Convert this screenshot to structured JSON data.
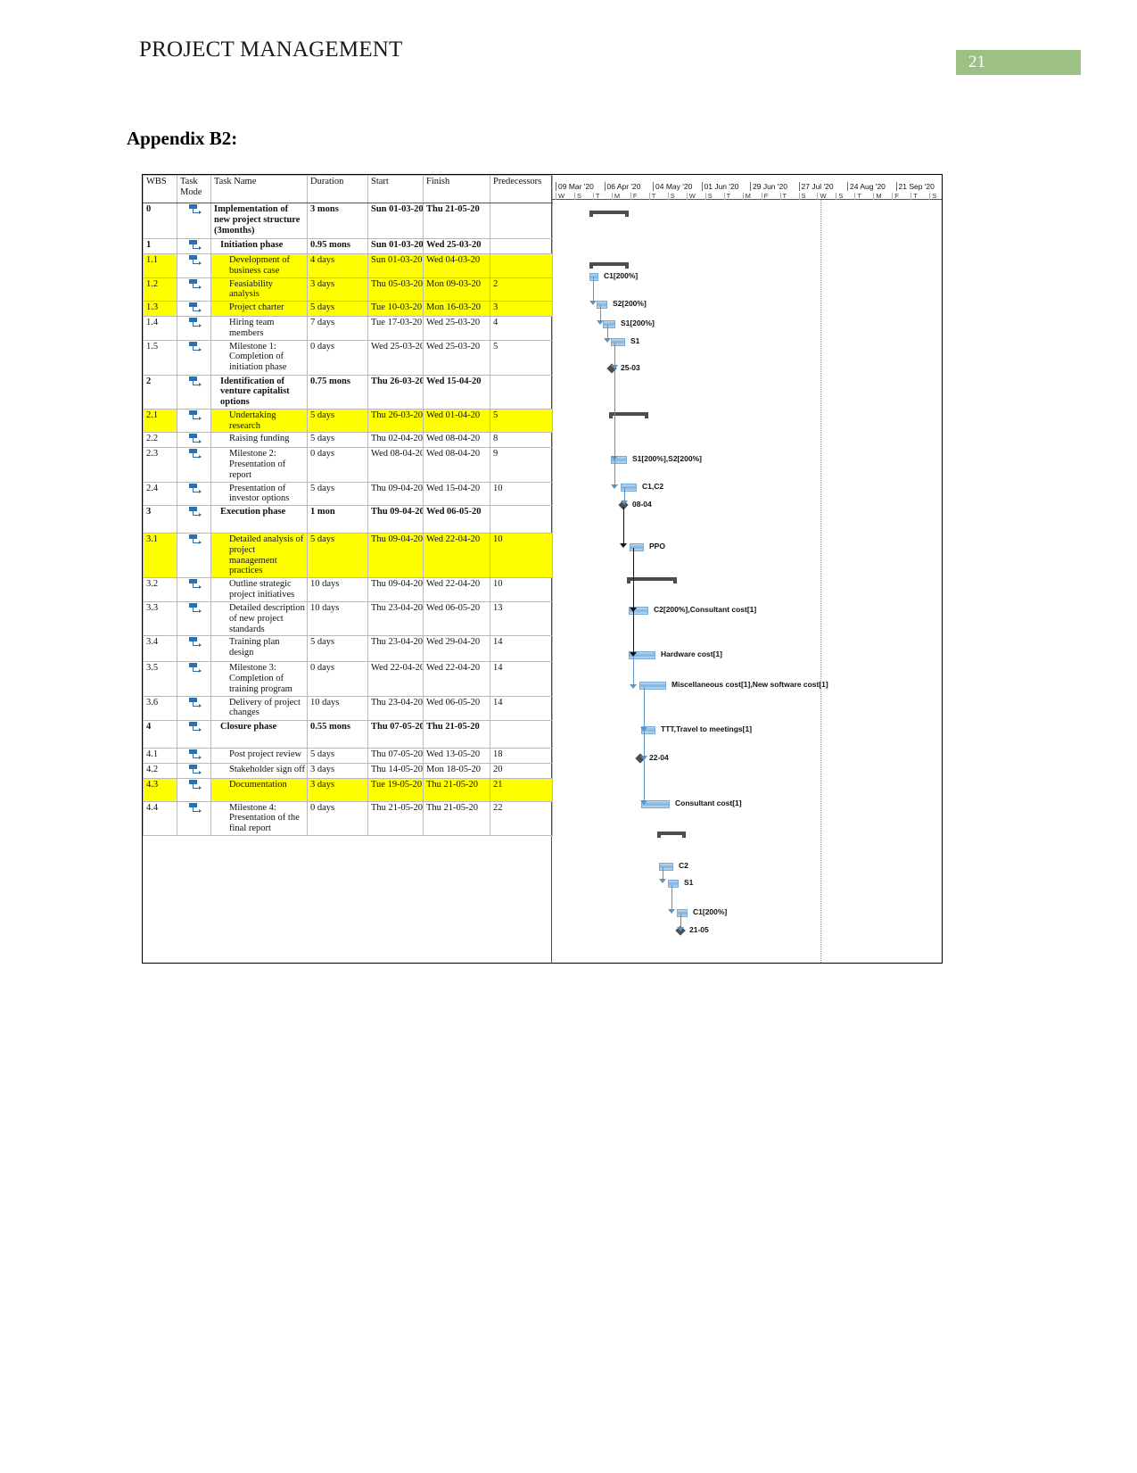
{
  "header": {
    "title": "PROJECT MANAGEMENT",
    "page_number": "21",
    "badge_color": "#9dc184"
  },
  "appendix": {
    "title": "Appendix B2:"
  },
  "table": {
    "columns": [
      "WBS",
      "Task Mode",
      "Task Name",
      "Duration",
      "Start",
      "Finish",
      "Predecessors"
    ],
    "column_headers": {
      "wbs": "WBS",
      "task_mode_line1": "Task",
      "task_mode_line2": "Mode",
      "task_name": "Task Name",
      "duration": "Duration",
      "start": "Start",
      "finish": "Finish",
      "predecessors": "Predecessors"
    },
    "highlight_color": "#ffff00",
    "rows": [
      {
        "wbs": "0",
        "name": "Implementation of new project structure (3months)",
        "duration": "3 mons",
        "start": "Sun 01-03-20",
        "finish": "Thu 21-05-20",
        "pred": "",
        "level": 0,
        "highlight": false
      },
      {
        "wbs": "1",
        "name": "Initiation phase",
        "duration": "0.95 mons",
        "start": "Sun 01-03-20",
        "finish": "Wed 25-03-20",
        "pred": "",
        "level": 1,
        "highlight": false
      },
      {
        "wbs": "1.1",
        "name": "Development of business case",
        "duration": "4 days",
        "start": "Sun 01-03-20",
        "finish": "Wed 04-03-20",
        "pred": "",
        "level": 2,
        "highlight": true
      },
      {
        "wbs": "1.2",
        "name": "Feasiability analysis",
        "duration": "3 days",
        "start": "Thu 05-03-20",
        "finish": "Mon 09-03-20",
        "pred": "2",
        "level": 2,
        "highlight": true
      },
      {
        "wbs": "1.3",
        "name": "Project charter",
        "duration": "5 days",
        "start": "Tue 10-03-20",
        "finish": "Mon 16-03-20",
        "pred": "3",
        "level": 2,
        "highlight": true
      },
      {
        "wbs": "1.4",
        "name": "Hiring team members",
        "duration": "7 days",
        "start": "Tue 17-03-20",
        "finish": "Wed 25-03-20",
        "pred": "4",
        "level": 2,
        "highlight": false
      },
      {
        "wbs": "1.5",
        "name": "Milestone 1: Completion of initiation phase",
        "duration": "0 days",
        "start": "Wed 25-03-20",
        "finish": "Wed 25-03-20",
        "pred": "5",
        "level": 2,
        "highlight": false
      },
      {
        "wbs": "2",
        "name": "Identification of venture capitalist options",
        "duration": "0.75 mons",
        "start": "Thu 26-03-20",
        "finish": "Wed 15-04-20",
        "pred": "",
        "level": 1,
        "highlight": false
      },
      {
        "wbs": "2.1",
        "name": "Undertaking research",
        "duration": "5 days",
        "start": "Thu 26-03-20",
        "finish": "Wed 01-04-20",
        "pred": "5",
        "level": 2,
        "highlight": true
      },
      {
        "wbs": "2.2",
        "name": "Raising funding",
        "duration": "5 days",
        "start": "Thu 02-04-20",
        "finish": "Wed 08-04-20",
        "pred": "8",
        "level": 2,
        "highlight": false
      },
      {
        "wbs": "2.3",
        "name": "Milestone 2: Presentation of report",
        "duration": "0 days",
        "start": "Wed 08-04-20",
        "finish": "Wed 08-04-20",
        "pred": "9",
        "level": 2,
        "highlight": false
      },
      {
        "wbs": "2.4",
        "name": "Presentation of investor options",
        "duration": "5 days",
        "start": "Thu 09-04-20",
        "finish": "Wed 15-04-20",
        "pred": "10",
        "level": 2,
        "highlight": false
      },
      {
        "wbs": "3",
        "name": "Execution phase",
        "duration": "1 mon",
        "start": "Thu 09-04-20",
        "finish": "Wed 06-05-20",
        "pred": "",
        "level": 1,
        "highlight": false
      },
      {
        "wbs": "3.1",
        "name": "Detailed analysis of project management practices",
        "duration": "5 days",
        "start": "Thu 09-04-20",
        "finish": "Wed 22-04-20",
        "pred": "10",
        "level": 2,
        "highlight": true
      },
      {
        "wbs": "3.2",
        "name": "Outline strategic project initiatives",
        "duration": "10 days",
        "start": "Thu 09-04-20",
        "finish": "Wed 22-04-20",
        "pred": "10",
        "level": 2,
        "highlight": false
      },
      {
        "wbs": "3.3",
        "name": "Detailed description of new project standards",
        "duration": "10 days",
        "start": "Thu 23-04-20",
        "finish": "Wed 06-05-20",
        "pred": "13",
        "level": 2,
        "highlight": false
      },
      {
        "wbs": "3.4",
        "name": "Training plan design",
        "duration": "5 days",
        "start": "Thu 23-04-20",
        "finish": "Wed 29-04-20",
        "pred": "14",
        "level": 2,
        "highlight": false
      },
      {
        "wbs": "3.5",
        "name": "Milestone 3: Completion of training program",
        "duration": "0 days",
        "start": "Wed 22-04-20",
        "finish": "Wed 22-04-20",
        "pred": "14",
        "level": 2,
        "highlight": false
      },
      {
        "wbs": "3.6",
        "name": "Delivery of project changes",
        "duration": "10 days",
        "start": "Thu 23-04-20",
        "finish": "Wed 06-05-20",
        "pred": "14",
        "level": 2,
        "highlight": false
      },
      {
        "wbs": "4",
        "name": "Closure phase",
        "duration": "0.55 mons",
        "start": "Thu 07-05-20",
        "finish": "Thu 21-05-20",
        "pred": "",
        "level": 1,
        "highlight": false
      },
      {
        "wbs": "4.1",
        "name": "Post project review",
        "duration": "5 days",
        "start": "Thu 07-05-20",
        "finish": "Wed 13-05-20",
        "pred": "18",
        "level": 2,
        "highlight": false
      },
      {
        "wbs": "4.2",
        "name": "Stakeholder sign off",
        "duration": "3 days",
        "start": "Thu 14-05-20",
        "finish": "Mon 18-05-20",
        "pred": "20",
        "level": 2,
        "highlight": false
      },
      {
        "wbs": "4.3",
        "name": "Documentation",
        "duration": "3 days",
        "start": "Tue 19-05-20",
        "finish": "Thu 21-05-20",
        "pred": "21",
        "level": 2,
        "highlight": true
      },
      {
        "wbs": "4.4",
        "name": "Milestone 4: Presentation of the final report",
        "duration": "0 days",
        "start": "Thu 21-05-20",
        "finish": "Thu 21-05-20",
        "pred": "22",
        "level": 2,
        "highlight": false
      }
    ]
  },
  "timeline": {
    "months": [
      "09 Mar '20",
      "06 Apr '20",
      "04 May '20",
      "01 Jun '20",
      "29 Jun '20",
      "27 Jul '20",
      "24 Aug '20",
      "21 Sep '20"
    ],
    "day_letters": [
      "W",
      "S",
      "T",
      "M",
      "F",
      "T",
      "S",
      "W",
      "S",
      "T",
      "M",
      "F",
      "T",
      "S",
      "W",
      "S",
      "T",
      "M",
      "F",
      "T",
      "S"
    ],
    "bars": [
      {
        "label": "C1[200%]",
        "type": "bar"
      },
      {
        "label": "S2[200%]",
        "type": "bar"
      },
      {
        "label": "S1[200%]",
        "type": "bar"
      },
      {
        "label": "S1",
        "type": "bar"
      },
      {
        "label": "25-03",
        "type": "milestone"
      },
      {
        "label": "S1[200%],S2[200%]",
        "type": "bar"
      },
      {
        "label": "C1,C2",
        "type": "bar"
      },
      {
        "label": "08-04",
        "type": "milestone"
      },
      {
        "label": "PPO",
        "type": "bar"
      },
      {
        "label": "C2[200%],Consultant cost[1]",
        "type": "bar"
      },
      {
        "label": "Hardware cost[1]",
        "type": "bar"
      },
      {
        "label": "Miscellaneous cost[1],New software cost[1]",
        "type": "bar"
      },
      {
        "label": "TTT,Travel to meetings[1]",
        "type": "bar"
      },
      {
        "label": "22-04",
        "type": "milestone"
      },
      {
        "label": "Consultant cost[1]",
        "type": "bar"
      },
      {
        "label": "C2",
        "type": "bar"
      },
      {
        "label": "S1",
        "type": "bar"
      },
      {
        "label": "C1[200%]",
        "type": "bar"
      },
      {
        "label": "21-05",
        "type": "milestone"
      }
    ]
  }
}
